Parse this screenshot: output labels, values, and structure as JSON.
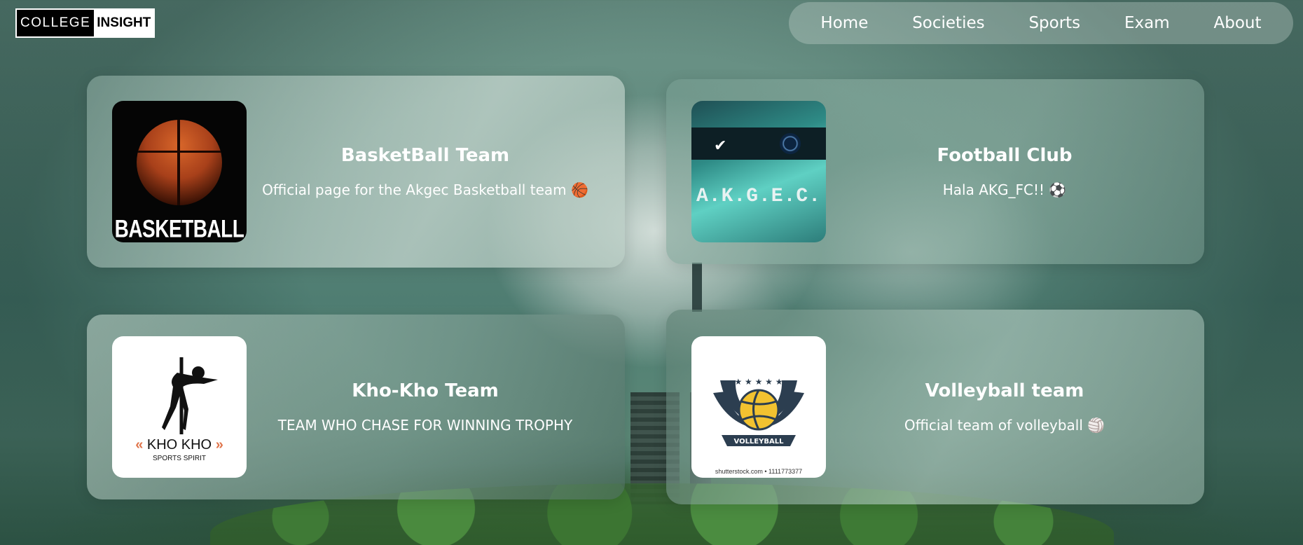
{
  "header": {
    "logo_part_a": "COLLEGE",
    "logo_part_b": "INSIGHT",
    "nav": [
      "Home",
      "Societies",
      "Sports",
      "Exam",
      "About"
    ]
  },
  "cards": [
    {
      "title": "BasketBall Team",
      "description": "Official page for the Akgec Basketball team 🏀",
      "image_text": "BASKETBALL"
    },
    {
      "title": "Football Club",
      "description": "Hala AKG_FC!! ⚽",
      "image_text": "A.K.G.E.C."
    },
    {
      "title": "Kho-Kho Team",
      "description": "TEAM WHO CHASE FOR WINNING TROPHY",
      "image_text": "KHO KHO",
      "image_subtext": "SPORTS SPIRIT"
    },
    {
      "title": "Volleyball team",
      "description": "Official team of volleyball 🏐",
      "image_text": "VOLLEYBALL",
      "image_credit": "shutterstock.com • 1111773377"
    }
  ],
  "colors": {
    "text": "#ffffff",
    "background": "#5d877b"
  }
}
